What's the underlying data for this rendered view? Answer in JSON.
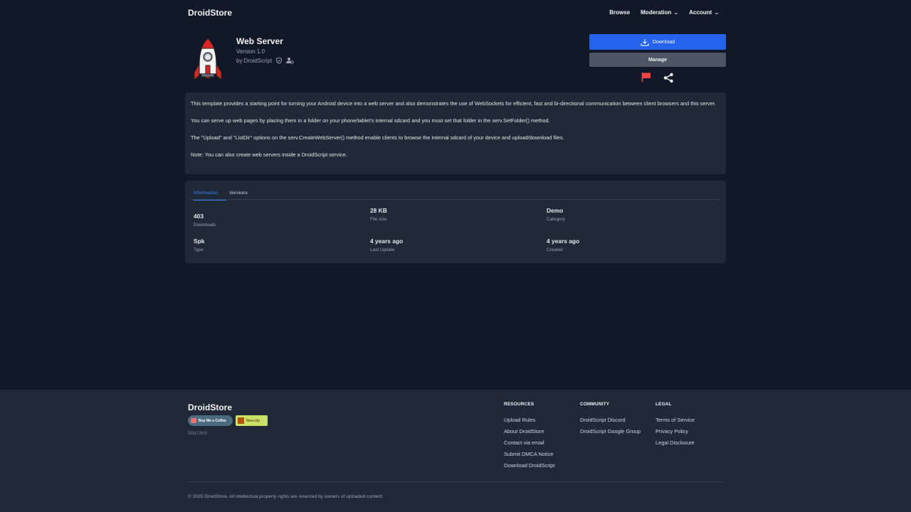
{
  "header": {
    "brand": "DroidStore",
    "nav": [
      {
        "label": "Browse",
        "dropdown": false
      },
      {
        "label": "Moderation",
        "dropdown": true
      },
      {
        "label": "Account",
        "dropdown": true
      }
    ]
  },
  "app": {
    "title": "Web Server",
    "version": "Version 1.0",
    "author": "by DroidScript",
    "download_label": "Download",
    "manage_label": "Manage",
    "icons": {
      "logo": "rocket-icon",
      "verified": "shield-check-icon",
      "team": "user-settings-icon",
      "report": "flag-icon",
      "share": "share-icon",
      "download": "download-icon"
    }
  },
  "description": [
    "This template provides a starting point for turning your Android device into a web server and also demonstrates the use of WebSockets for efficient, fast and bi-directional communication between client browsers and this server.",
    "You can serve up web pages by placing them in a folder on your phone/tablet's internal sdcard and you must set that folder in the serv.SetFolder() method.",
    "The \"Upload\" and \"ListDir\" options on the serv.CreateWebServer() method enable clients to browse the internal sdcard of your device and upload/download files.",
    "Note: You can also create web servers inside a DroidScript service."
  ],
  "info": {
    "tabs": [
      "Information",
      "Versions"
    ],
    "active_tab": "Information",
    "stats": [
      {
        "value": "403",
        "label": "Downloads"
      },
      {
        "value": "28 KB",
        "label": "File size"
      },
      {
        "value": "Demo",
        "label": "Category"
      },
      {
        "value": "Spk",
        "label": "Type"
      },
      {
        "value": "4 years ago",
        "label": "Last Update"
      },
      {
        "value": "4 years ago",
        "label": "Created"
      }
    ]
  },
  "footer": {
    "brand": "DroidStore",
    "badge_coffee": "Buy Me a Coffee",
    "badge_fma": "fma-city",
    "hash": "b8a19e6",
    "columns": [
      {
        "title": "RESOURCES",
        "links": [
          "Upload Rules",
          "About DroidStore",
          "Contact via email",
          "Submit DMCA Notice",
          "Download DroidScript"
        ]
      },
      {
        "title": "COMMUNITY",
        "links": [
          "DroidScript Discord",
          "DroidScript Google Group"
        ]
      },
      {
        "title": "LEGAL",
        "links": [
          "Terms of Service",
          "Privacy Policy",
          "Legal Disclosure"
        ]
      }
    ],
    "copyright": "© 2025 DroidStore, All intellectual property rights are reserved by owners of uploaded content."
  },
  "colors": {
    "background": "#111827",
    "card": "#1f2937",
    "accent": "#2563eb",
    "flag": "#ef4444"
  }
}
